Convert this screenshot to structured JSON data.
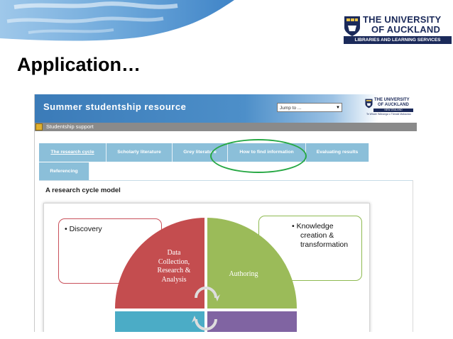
{
  "slide": {
    "title": "Application…",
    "logo": {
      "line1": "THE UNIVERSITY",
      "line2": "OF AUCKLAND",
      "bar": "LIBRARIES AND LEARNING SERVICES"
    }
  },
  "screenshot": {
    "site_title": "Summer studentship resource",
    "jump_to": "Jump to ...",
    "logo": {
      "line1": "THE UNIVERSITY",
      "line2": "OF AUCKLAND",
      "country": "NEW ZEALAND",
      "tagline": "Te Whare Wānanga o Tāmaki Makaurau"
    },
    "breadcrumb": "Studentship support",
    "tabs": [
      {
        "label": "The research cycle",
        "active": true
      },
      {
        "label": "Scholarly literature",
        "active": false
      },
      {
        "label": "Grey literature",
        "active": false
      },
      {
        "label": "How to find information",
        "active": false
      },
      {
        "label": "Evaluating results",
        "active": false
      },
      {
        "label": "Referencing",
        "active": false
      }
    ],
    "section_title": "A research cycle model",
    "diagram": {
      "discovery": "• Discovery",
      "knowledge": [
        "• Knowledge",
        "creation &",
        "transformation"
      ],
      "data_collection": [
        "Data",
        "Collection,",
        "Research &",
        "Analysis"
      ],
      "authoring": "Authoring"
    }
  },
  "colors": {
    "header_blue": "#3b7bb8",
    "tab_blue": "#8bbfd9",
    "segment_red": "#c44d4f",
    "segment_green": "#9bbb59",
    "segment_teal": "#4bacc6",
    "segment_purple": "#8064a2",
    "highlight_green": "#27a844",
    "logo_navy": "#1b2a5a"
  }
}
